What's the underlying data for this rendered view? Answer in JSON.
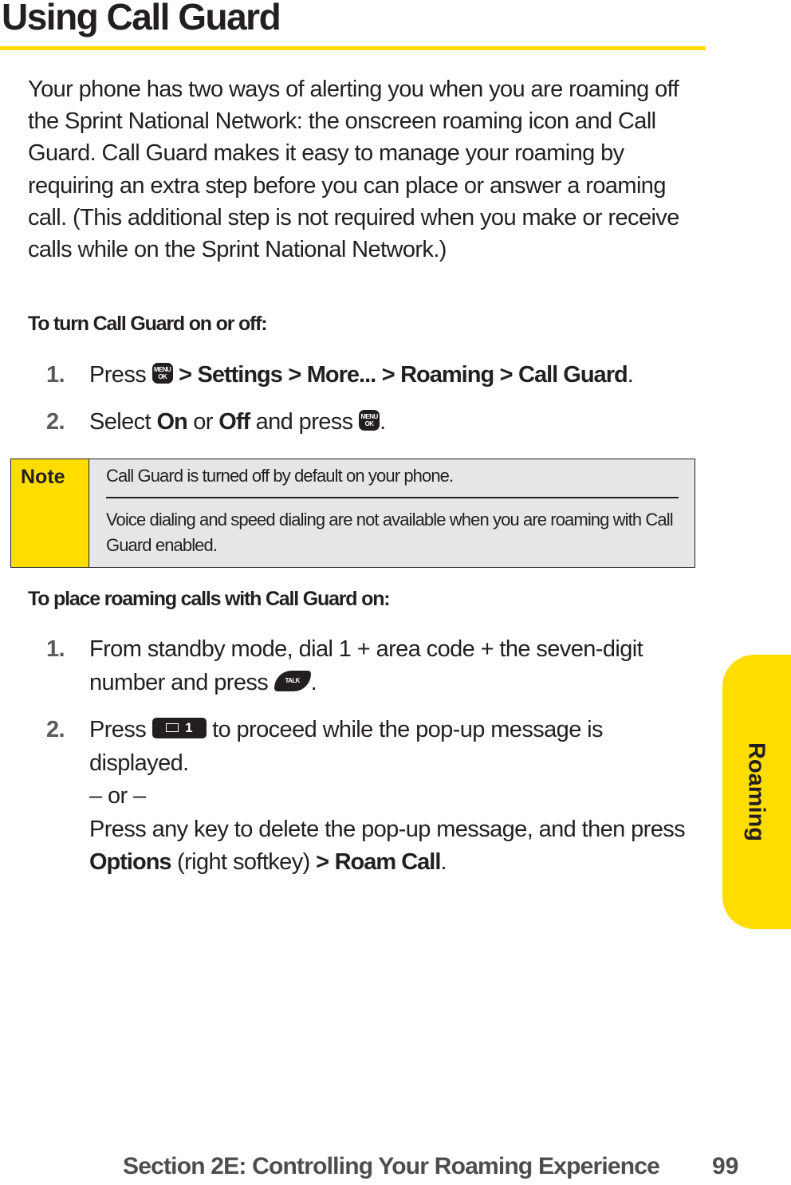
{
  "page": {
    "title": "Using Call Guard",
    "intro": "Your phone has two ways of alerting you when you are roaming off the Sprint National Network: the onscreen roaming icon and Call Guard. Call Guard makes it easy to manage your roaming by requiring an extra step before you can place or answer a roaming call. (This additional step is not required when you make or receive calls while on the Sprint National Network.)",
    "accent_color": "#ffdd00"
  },
  "section1": {
    "heading": "To turn Call Guard on or off:",
    "steps": [
      {
        "num": "1.",
        "press": "Press",
        "key": "MENU OK",
        "key_top": "MENU",
        "key_bottom": "OK",
        "path": [
          "Settings",
          "More...",
          "Roaming",
          "Call Guard"
        ],
        "sep": ">",
        "end": "."
      },
      {
        "num": "2.",
        "select": "Select",
        "opt1": "On",
        "or": "or",
        "opt2": "Off",
        "and_press": "and press",
        "key_top": "MENU",
        "key_bottom": "OK",
        "end": "."
      }
    ]
  },
  "note": {
    "label": "Note",
    "line1": "Call Guard is turned off by default on your phone.",
    "line2": "Voice dialing and speed dialing are not available when you are roaming with Call Guard enabled."
  },
  "section2": {
    "heading": "To place roaming calls with Call Guard on:",
    "steps": [
      {
        "num": "1.",
        "text": "From standby mode, dial 1 + area code + the seven-digit number and press",
        "key": "TALK",
        "end": "."
      },
      {
        "num": "2.",
        "press": "Press",
        "key": "1",
        "text_a": "to proceed while the pop-up message is displayed.",
        "or": "– or –",
        "text_b": "Press any key to delete the pop-up message, and then press",
        "options": "Options",
        "softkey": "(right softkey)",
        "sep": ">",
        "roam_call": "Roam Call",
        "end": "."
      }
    ]
  },
  "side_tab": {
    "label": "Roaming"
  },
  "footer": {
    "section": "Section 2E: Controlling Your Roaming Experience",
    "page_number": "99"
  }
}
